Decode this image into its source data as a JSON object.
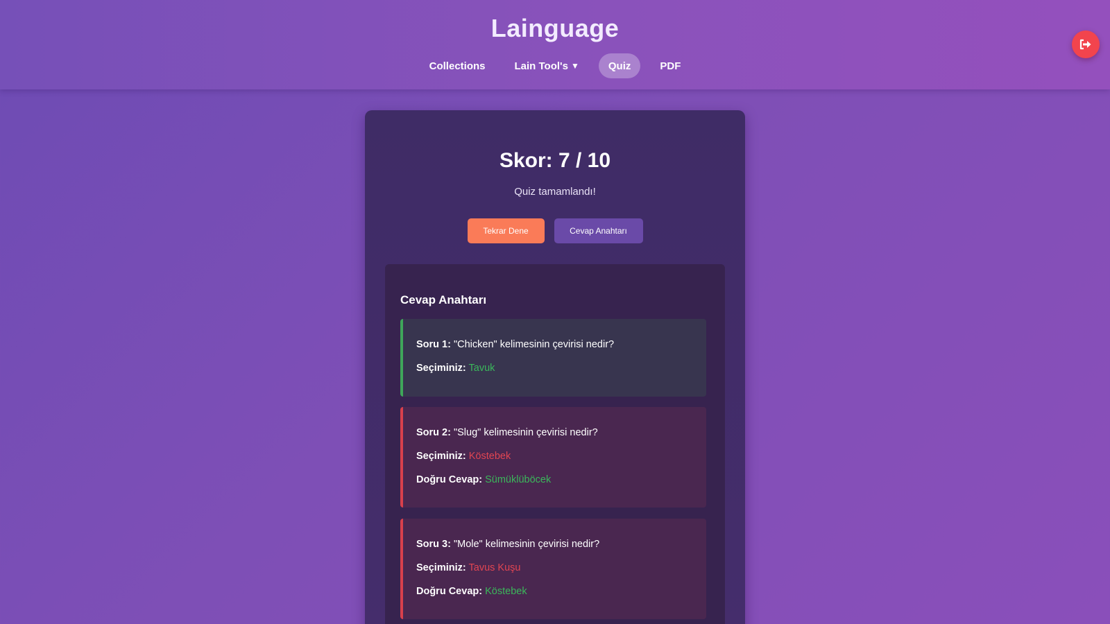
{
  "app": {
    "title": "Lainguage"
  },
  "nav": {
    "items": [
      {
        "label": "Collections",
        "active": false
      },
      {
        "label": "Lain Tool's",
        "active": false,
        "has_dropdown": true
      },
      {
        "label": "Quiz",
        "active": true
      },
      {
        "label": "PDF",
        "active": false
      }
    ],
    "caret_glyph": "▼",
    "logout_icon": "logout-icon"
  },
  "result": {
    "score_text": "Skor: 7 / 10",
    "status_text": "Quiz tamamlandı!",
    "retry_label": "Tekrar Dene",
    "answer_key_label": "Cevap Anahtarı"
  },
  "answer_key": {
    "title": "Cevap Anahtarı",
    "choice_label": "Seçiminiz:",
    "correct_label": "Doğru Cevap:",
    "questions": [
      {
        "prefix": "Soru 1:",
        "text": "\"Chicken\" kelimesinin çevirisi nedir?",
        "choice": "Tavuk",
        "is_correct": true,
        "correct_answer": ""
      },
      {
        "prefix": "Soru 2:",
        "text": "\"Slug\" kelimesinin çevirisi nedir?",
        "choice": "Köstebek",
        "is_correct": false,
        "correct_answer": "Sümüklüböcek"
      },
      {
        "prefix": "Soru 3:",
        "text": "\"Mole\" kelimesinin çevirisi nedir?",
        "choice": "Tavus Kuşu",
        "is_correct": false,
        "correct_answer": "Köstebek"
      }
    ]
  },
  "colors": {
    "correct": "#3bb75b",
    "wrong": "#e14552",
    "retry_button": "#fa7b58",
    "key_button": "#6a4aa8",
    "logout_button": "#f2444d"
  }
}
